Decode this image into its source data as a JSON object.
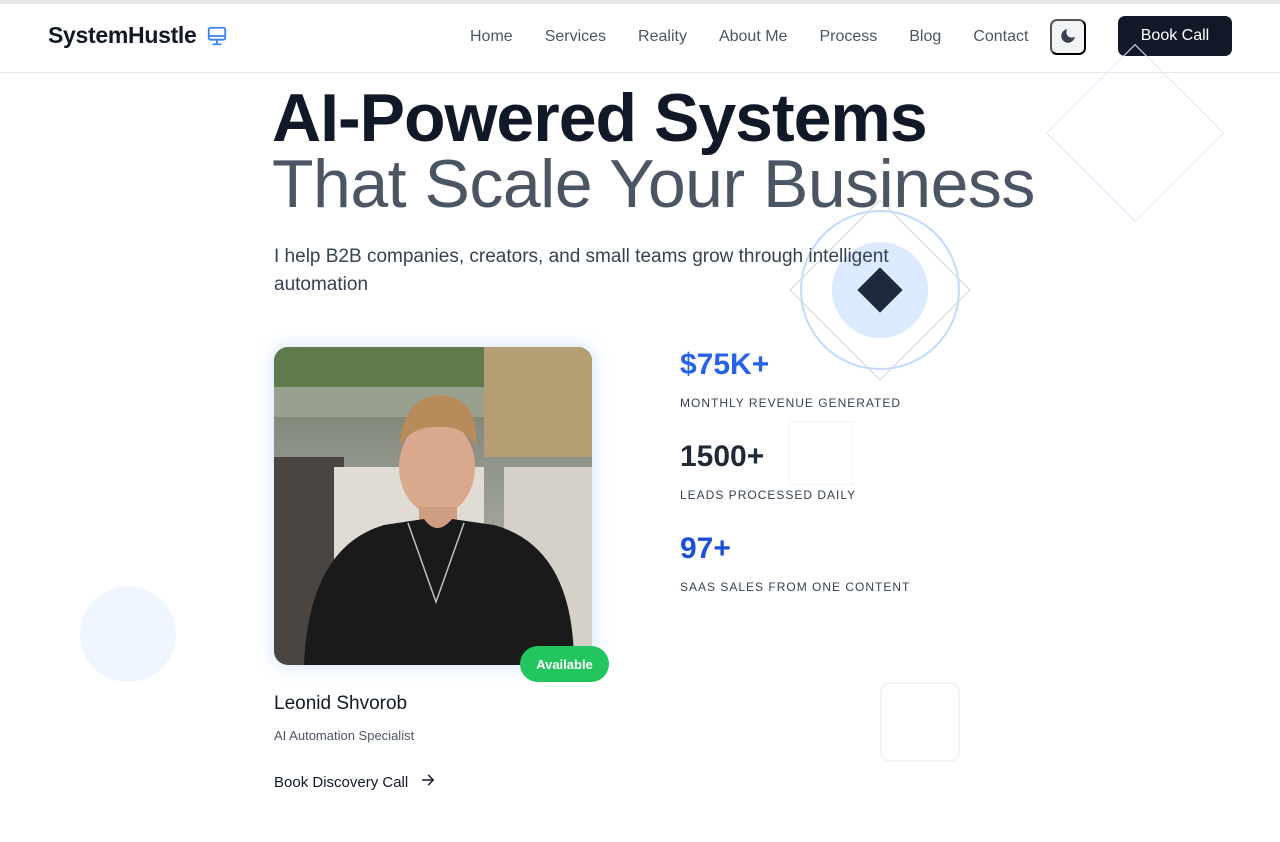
{
  "brand": {
    "name": "SystemHustle",
    "icon": "monitor-icon",
    "accent": "#3b82f6"
  },
  "nav": {
    "links": [
      "Home",
      "Services",
      "Reality",
      "About Me",
      "Process",
      "Blog",
      "Contact"
    ],
    "theme_toggle_icon": "moon-icon",
    "cta_label": "Book Call"
  },
  "hero": {
    "title_line1": "AI-Powered Systems",
    "title_line2": "That Scale Your Business",
    "subtitle": "I help B2B companies, creators, and small teams grow through intelligent automation"
  },
  "profile": {
    "status_badge": "Available",
    "name": "Leonid Shvorob",
    "role": "AI Automation Specialist",
    "cta_label": "Book Discovery Call",
    "cta_icon": "arrow-right-icon"
  },
  "stats": [
    {
      "value": "$75K+",
      "label": "MONTHLY REVENUE GENERATED",
      "color": "#2563eb"
    },
    {
      "value": "1500+",
      "label": "LEADS PROCESSED DAILY",
      "color": "#1f2937"
    },
    {
      "value": "97+",
      "label": "SAAS SALES FROM ONE CONTENT",
      "color": "#1d4ed8"
    }
  ],
  "colors": {
    "dark": "#111827",
    "badge_green": "#22c55e",
    "light_blue": "#dbeafe"
  }
}
